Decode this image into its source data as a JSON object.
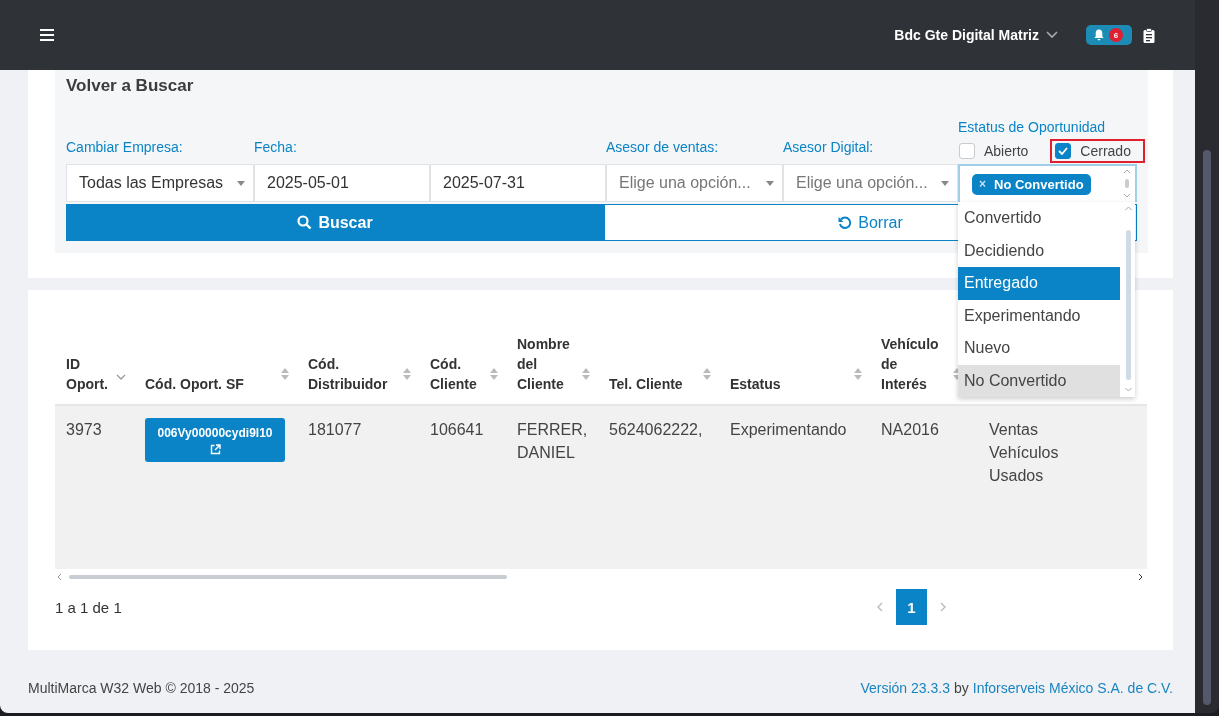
{
  "topbar": {
    "company": "Bdc Gte Digital Matriz",
    "notifications": "6"
  },
  "search": {
    "title": "Volver a Buscar",
    "fields": [
      {
        "kind": "select",
        "label": "Cambiar Empresa:",
        "value": "Todas las Empresas"
      },
      {
        "kind": "text",
        "label": "Fecha:",
        "value": "2025-05-01"
      },
      {
        "kind": "text",
        "value": "2025-07-31"
      },
      {
        "kind": "select",
        "label": "Asesor de ventas:",
        "placeholder": "Elige una opción..."
      },
      {
        "kind": "select",
        "label": "Asesor Digital:",
        "placeholder": "Elige una opción..."
      }
    ],
    "status": {
      "label": "Estatus de Oportunidad",
      "checkboxes": [
        {
          "label": "Abierto",
          "checked": false
        },
        {
          "label": "Cerrado",
          "checked": true,
          "highlighted": true
        }
      ],
      "tags": [
        {
          "label": "No Convertido",
          "remove": "×"
        }
      ],
      "options": [
        {
          "label": "Convertido",
          "highlighted": false,
          "selected": false
        },
        {
          "label": "Decidiendo",
          "highlighted": false,
          "selected": false
        },
        {
          "label": "Entregado",
          "highlighted": true,
          "selected": false
        },
        {
          "label": "Experimentando",
          "highlighted": false,
          "selected": false
        },
        {
          "label": "Nuevo",
          "highlighted": false,
          "selected": false
        },
        {
          "label": "No Convertido",
          "highlighted": false,
          "selected": true
        }
      ]
    },
    "buttons": [
      {
        "kind": "primary",
        "label": "Buscar"
      },
      {
        "kind": "secondary",
        "label": "Borrar"
      }
    ]
  },
  "table": {
    "columns": [
      {
        "label": "ID Oport.",
        "sorted": true
      },
      {
        "label": "Cód. Oport. SF",
        "sorted": false
      },
      {
        "label": "Cód. Distribuidor",
        "sorted": false
      },
      {
        "label": "Cód. Cliente",
        "sorted": false
      },
      {
        "label": "Nombre del Cliente",
        "sorted": false
      },
      {
        "label": "Tel. Cliente",
        "sorted": false
      },
      {
        "label": "Estatus",
        "sorted": false
      },
      {
        "label": "Vehículo de Interés",
        "sorted": false
      },
      {}
    ],
    "rows": [
      {
        "cells": [
          {
            "text": "3973"
          },
          {
            "kind": "link",
            "text": "006Vy00000cydi9l10"
          },
          {
            "text": "181077"
          },
          {
            "text": "106641"
          },
          {
            "text": "FERRER, DANIEL"
          },
          {
            "text": "5624062222,"
          },
          {
            "text": "Experimentando"
          },
          {
            "text": "NA2016"
          },
          {
            "text": "Ventas Vehículos Usados"
          }
        ]
      }
    ]
  },
  "pagination": {
    "info": "1 a 1 de 1",
    "pages": [
      {
        "label": "1",
        "selected": true
      }
    ]
  },
  "footer": {
    "copyright": "MultiMarca W32 Web © 2018 - 2025",
    "version": "Versión 23.3.3",
    "by": "by",
    "company": "Inforserveis México S.A. de C.V."
  }
}
